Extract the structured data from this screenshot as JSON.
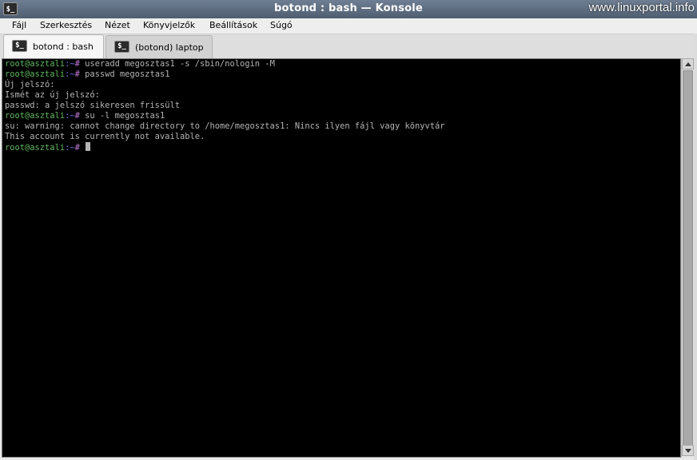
{
  "window": {
    "title": "botond : bash — Konsole",
    "app_icon": "$_",
    "watermark": "www.linuxportal.info"
  },
  "menu": [
    {
      "label": "Fájl"
    },
    {
      "label": "Szerkesztés"
    },
    {
      "label": "Nézet"
    },
    {
      "label": "Könyvjelzők"
    },
    {
      "label": "Beállítások"
    },
    {
      "label": "Súgó"
    }
  ],
  "tabs": [
    {
      "label": "botond : bash",
      "icon": "$_",
      "active": true
    },
    {
      "label": "(botond) laptop",
      "icon": "$_",
      "active": false
    }
  ],
  "prompt": {
    "user_host": "root@asztali",
    "path": ":~",
    "hash": "#"
  },
  "terminal": {
    "lines": [
      {
        "type": "prompt",
        "cmd": " useradd megosztas1 -s /sbin/nologin -M"
      },
      {
        "type": "prompt",
        "cmd": " passwd megosztas1"
      },
      {
        "type": "output",
        "text": "Új jelszó:"
      },
      {
        "type": "output",
        "text": "Ismét az új jelszó:"
      },
      {
        "type": "output",
        "text": "passwd: a jelszó sikeresen frissült"
      },
      {
        "type": "prompt",
        "cmd": " su -l megosztas1"
      },
      {
        "type": "output",
        "text": "su: warning: cannot change directory to /home/megosztas1: Nincs ilyen fájl vagy könyvtár"
      },
      {
        "type": "output",
        "text": "This account is currently not available."
      },
      {
        "type": "prompt",
        "cmd": " ",
        "cursor": true
      }
    ]
  },
  "colors": {
    "prompt_user": "#5fb85f",
    "prompt_path": "#5f6fe0",
    "prompt_hash": "#c27bd8",
    "output": "#b4b4b4",
    "background": "#000000"
  }
}
